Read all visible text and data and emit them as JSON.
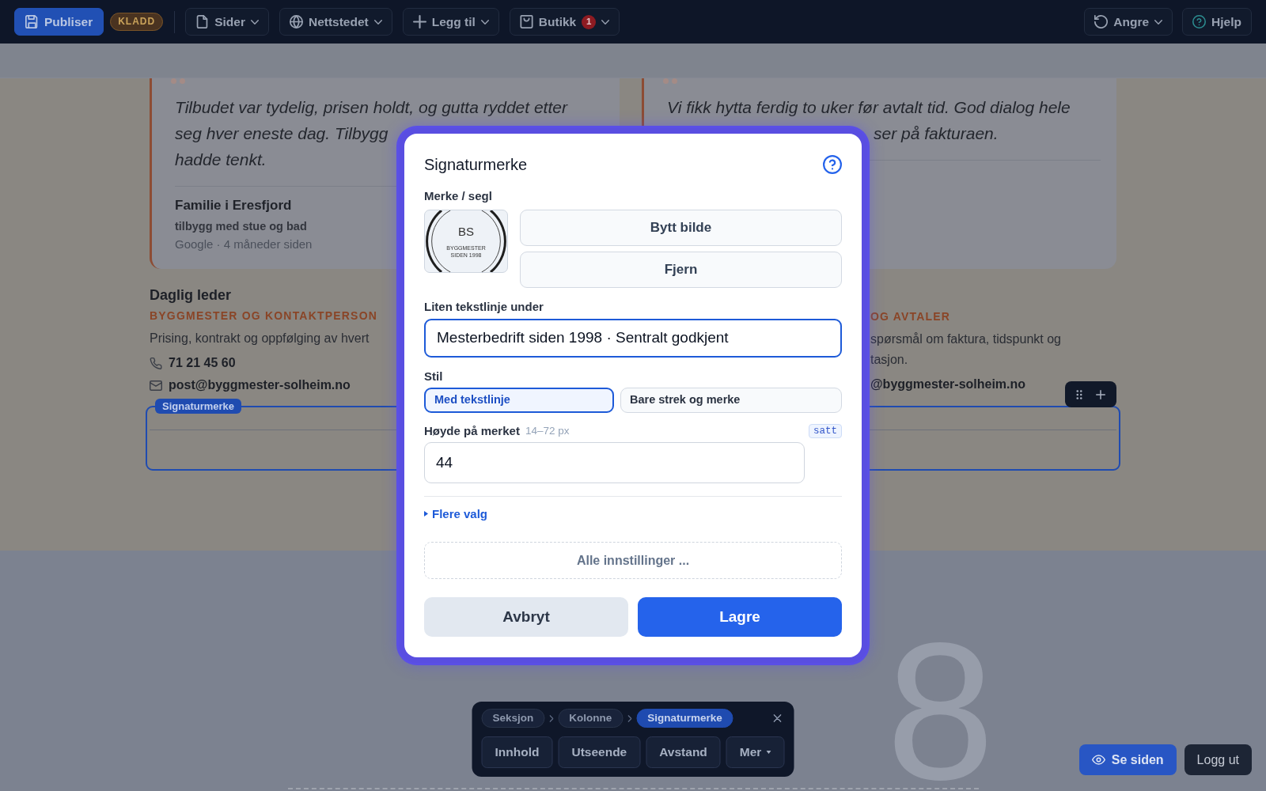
{
  "toolbar": {
    "publish": "Publiser",
    "status_badge": "KLADD",
    "menus": [
      {
        "label": "Sider",
        "dropdown": true
      },
      {
        "label": "Nettstedet",
        "dropdown": true
      },
      {
        "label": "Legg til",
        "dropdown": true
      },
      {
        "label": "Butikk",
        "count": "1",
        "dropdown": true
      }
    ],
    "right": [
      {
        "label": "Angre",
        "dropdown": true
      },
      {
        "label": "Hjelp",
        "dropdown": false
      }
    ]
  },
  "reviews": [
    {
      "quote_lines": [
        "Tilbudet var tydelig, prisen holdt, og gutta ryddet etter",
        "seg hver eneste dag. Tilbygg",
        "hadde tenkt."
      ],
      "author": "Familie i Eresfjord",
      "project": "tilbygg med stue og bad",
      "source": "Google · 4 måneder siden"
    },
    {
      "quote_lines": [
        "Vi fikk hytta ferdig to uker før avtalt tid. God dialog hele",
        "ser på fakturaen."
      ]
    }
  ],
  "contacts": [
    {
      "title": "Daglig leder",
      "role": "BYGGMESTER OG KONTAKTPERSON",
      "description_lines": [
        "Prising, kontrakt og oppfølging av hvert"
      ],
      "phone": "71 21 45 60",
      "email": "post@byggmester-solheim.no"
    },
    {
      "role": "OG AVTALER",
      "description_lines": [
        "spørsmål om faktura, tidspunkt og",
        "tasjon."
      ],
      "email": "@byggmester-solheim.no"
    }
  ],
  "selected_block": {
    "label": "Signaturmerke"
  },
  "decor_text": "8",
  "dialog": {
    "title": "Signaturmerke",
    "logo_label": "Merke / segl",
    "logo": {
      "initials": "BS",
      "line_1": "BYGGMESTER",
      "line_2": "SIDEN 1998"
    },
    "logo_buttons": [
      "Bytt bilde",
      "Fjern"
    ],
    "caption": {
      "label": "Liten tekstlinje under",
      "value": "Mesterbedrift siden 1998 · Sentralt godkjent",
      "focused": true
    },
    "style": {
      "label": "Stil",
      "options": [
        {
          "label": "Med tekstlinje",
          "selected": true
        },
        {
          "label": "Bare strek og merke",
          "selected": false
        }
      ]
    },
    "height": {
      "label": "Høyde på merket",
      "hint": "14–72 px",
      "badge": "satt",
      "value": "44"
    },
    "more_link": "Flere valg",
    "all_settings": "Alle innstillinger ...",
    "buttons": [
      {
        "label": "Avbryt",
        "kind": "secondary"
      },
      {
        "label": "Lagre",
        "kind": "primary"
      }
    ]
  },
  "block_toolbar": {
    "breadcrumb": [
      {
        "label": "Seksjon",
        "selected": false
      },
      {
        "label": "Kolonne",
        "selected": false
      },
      {
        "label": "Signaturmerke",
        "selected": true
      }
    ],
    "actions": [
      {
        "label": "Innhold",
        "dropdown": false
      },
      {
        "label": "Utseende",
        "dropdown": false
      },
      {
        "label": "Avstand",
        "dropdown": false
      },
      {
        "label": "Mer",
        "dropdown": true
      }
    ]
  },
  "page_actions": [
    {
      "label": "Se siden",
      "kind": "primary"
    },
    {
      "label": "Logg ut",
      "kind": "secondary"
    }
  ]
}
